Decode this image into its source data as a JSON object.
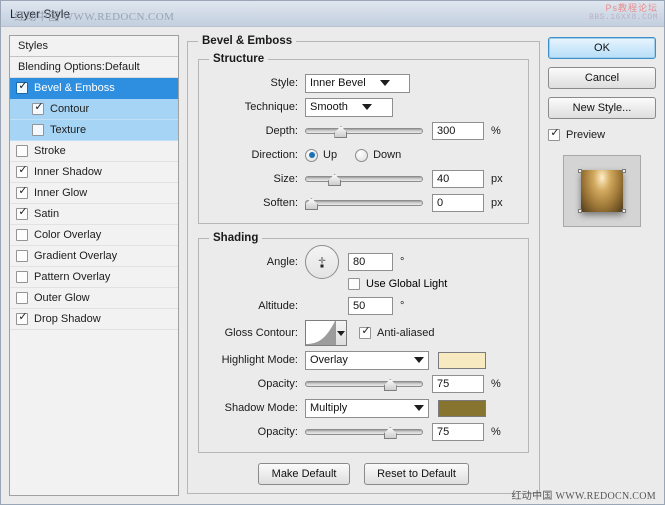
{
  "window": {
    "title": "Layer Style",
    "watermark_title": "红动中国 WWW.REDOCN.COM",
    "watermark_topright_line1": "Ps教程论坛",
    "watermark_topright_line2": "BBS.16XX8.COM",
    "watermark_bottom": "红动中国 WWW.REDOCN.COM"
  },
  "styles_panel": {
    "header": "Styles",
    "blending_options": "Blending Options:Default",
    "items": [
      {
        "label": "Bevel & Emboss",
        "checked": true,
        "selected": true,
        "sub": false
      },
      {
        "label": "Contour",
        "checked": true,
        "selected": false,
        "sub": true
      },
      {
        "label": "Texture",
        "checked": false,
        "selected": false,
        "sub": true
      },
      {
        "label": "Stroke",
        "checked": false,
        "selected": false,
        "sub": false
      },
      {
        "label": "Inner Shadow",
        "checked": true,
        "selected": false,
        "sub": false
      },
      {
        "label": "Inner Glow",
        "checked": true,
        "selected": false,
        "sub": false
      },
      {
        "label": "Satin",
        "checked": true,
        "selected": false,
        "sub": false
      },
      {
        "label": "Color Overlay",
        "checked": false,
        "selected": false,
        "sub": false
      },
      {
        "label": "Gradient Overlay",
        "checked": false,
        "selected": false,
        "sub": false
      },
      {
        "label": "Pattern Overlay",
        "checked": false,
        "selected": false,
        "sub": false
      },
      {
        "label": "Outer Glow",
        "checked": false,
        "selected": false,
        "sub": false
      },
      {
        "label": "Drop Shadow",
        "checked": true,
        "selected": false,
        "sub": false
      }
    ]
  },
  "main": {
    "group_title": "Bevel & Emboss",
    "structure": {
      "title": "Structure",
      "style_label": "Style:",
      "style_value": "Inner Bevel",
      "technique_label": "Technique:",
      "technique_value": "Smooth",
      "depth_label": "Depth:",
      "depth_value": "300",
      "depth_unit": "%",
      "depth_percent": 28,
      "direction_label": "Direction:",
      "direction_up": "Up",
      "direction_down": "Down",
      "direction_selected": "Up",
      "size_label": "Size:",
      "size_value": "40",
      "size_unit": "px",
      "size_percent": 22,
      "soften_label": "Soften:",
      "soften_value": "0",
      "soften_unit": "px",
      "soften_percent": 0
    },
    "shading": {
      "title": "Shading",
      "angle_label": "Angle:",
      "angle_value": "80",
      "angle_unit": "°",
      "use_global_light": "Use Global Light",
      "use_global_light_checked": false,
      "altitude_label": "Altitude:",
      "altitude_value": "50",
      "altitude_unit": "°",
      "gloss_contour_label": "Gloss Contour:",
      "anti_aliased": "Anti-aliased",
      "anti_aliased_checked": true,
      "highlight_mode_label": "Highlight Mode:",
      "highlight_mode_value": "Overlay",
      "highlight_color": "#f7e9c0",
      "highlight_opacity_label": "Opacity:",
      "highlight_opacity_value": "75",
      "highlight_opacity_unit": "%",
      "highlight_opacity_percent": 75,
      "shadow_mode_label": "Shadow Mode:",
      "shadow_mode_value": "Multiply",
      "shadow_color": "#87742e",
      "shadow_opacity_label": "Opacity:",
      "shadow_opacity_value": "75",
      "shadow_opacity_unit": "%",
      "shadow_opacity_percent": 75
    },
    "make_default": "Make Default",
    "reset_to_default": "Reset to Default"
  },
  "right": {
    "ok": "OK",
    "cancel": "Cancel",
    "new_style": "New Style...",
    "preview": "Preview",
    "preview_checked": true
  },
  "colors": {
    "selection_blue": "#2e8fe0",
    "sub_blue": "#a6d4f4",
    "dialog_bg": "#ebebeb"
  }
}
